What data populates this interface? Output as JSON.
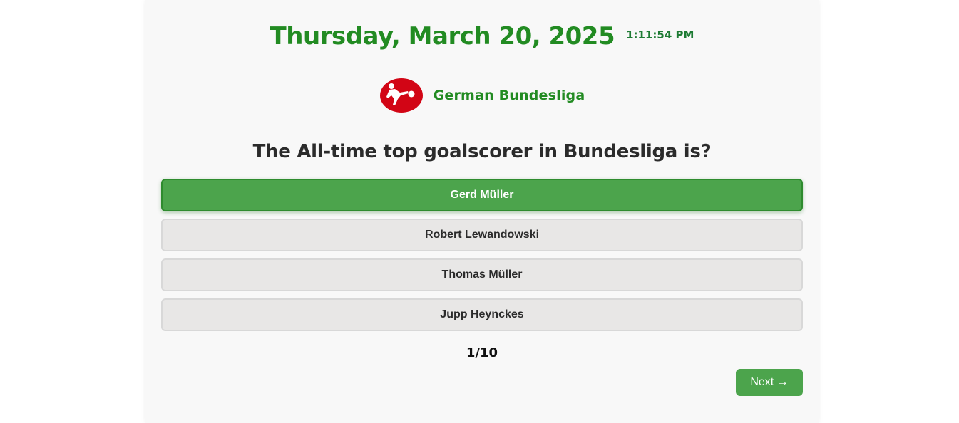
{
  "header": {
    "date": "Thursday, March 20, 2025",
    "time": "1:11:54 PM"
  },
  "league": {
    "name": "German Bundesliga",
    "logo_icon": "bundesliga-logo-icon"
  },
  "quiz": {
    "question": "The All-time top goalscorer in Bundesliga is?",
    "options": [
      {
        "label": "Gerd Müller",
        "selected": true
      },
      {
        "label": "Robert Lewandowski",
        "selected": false
      },
      {
        "label": "Thomas Müller",
        "selected": false
      },
      {
        "label": "Jupp Heynckes",
        "selected": false
      }
    ],
    "progress": "1/10",
    "next_label": "Next →"
  },
  "colors": {
    "accent": "#228b22",
    "selected_option": "#4ca44c",
    "option_bg": "#e8e7e6",
    "logo_red": "#d20515"
  }
}
